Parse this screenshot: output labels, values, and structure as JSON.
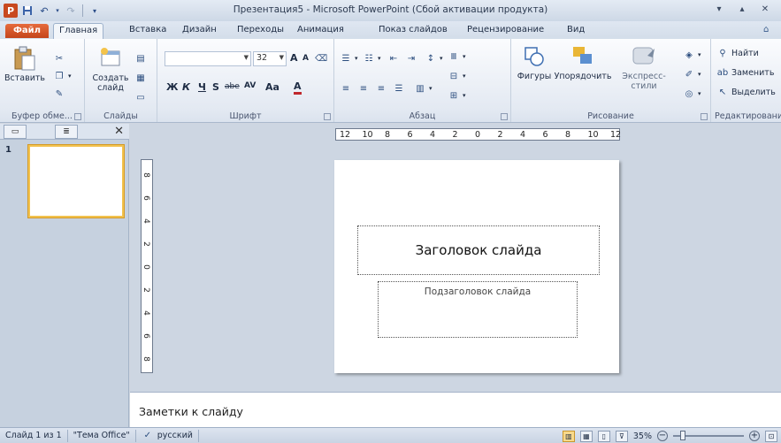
{
  "window": {
    "title": "Презентация5 - Microsoft PowerPoint (Сбой активации продукта)",
    "logo_letter": "P"
  },
  "tabs": [
    {
      "label": "Файл"
    },
    {
      "label": "Главная"
    },
    {
      "label": "Вставка"
    },
    {
      "label": "Дизайн"
    },
    {
      "label": "Переходы"
    },
    {
      "label": "Анимация"
    },
    {
      "label": "Показ слайдов"
    },
    {
      "label": "Рецензирование"
    },
    {
      "label": "Вид"
    }
  ],
  "ribbon": {
    "clipboard": {
      "paste": "Вставить",
      "label": "Буфер обме..."
    },
    "slides": {
      "new_slide_line1": "Создать",
      "new_slide_line2": "слайд",
      "label": "Слайды"
    },
    "font": {
      "size": "32",
      "bold": "Ж",
      "italic": "К",
      "underline": "Ч",
      "strike": "S",
      "abc": "abe",
      "spacing": "AV",
      "case": "Aa",
      "color": "A",
      "grow": "A",
      "shrink": "A",
      "label": "Шрифт"
    },
    "paragraph": {
      "label": "Абзац"
    },
    "drawing": {
      "shapes": "Фигуры",
      "arrange": "Упорядочить",
      "quick_styles": "Экспресс-стили",
      "label": "Рисование"
    },
    "editing": {
      "find": "Найти",
      "replace": "Заменить",
      "select": "Выделить",
      "label": "Редактировани"
    }
  },
  "left_pane": {
    "slide_number": "1"
  },
  "ruler": {
    "h_ticks": [
      "12",
      "10",
      "8",
      "6",
      "4",
      "2",
      "0",
      "2",
      "4",
      "6",
      "8",
      "10",
      "12"
    ],
    "v_ticks": [
      "8",
      "6",
      "4",
      "2",
      "0",
      "2",
      "4",
      "6",
      "8"
    ]
  },
  "slide": {
    "title_placeholder": "Заголовок слайда",
    "subtitle_placeholder": "Подзаголовок слайда"
  },
  "notes": {
    "placeholder": "Заметки к слайду"
  },
  "status": {
    "slide_info": "Слайд 1 из 1",
    "theme": "\"Тема Office\"",
    "language": "русский",
    "zoom": "35%",
    "zoom_level_percent": 35
  }
}
